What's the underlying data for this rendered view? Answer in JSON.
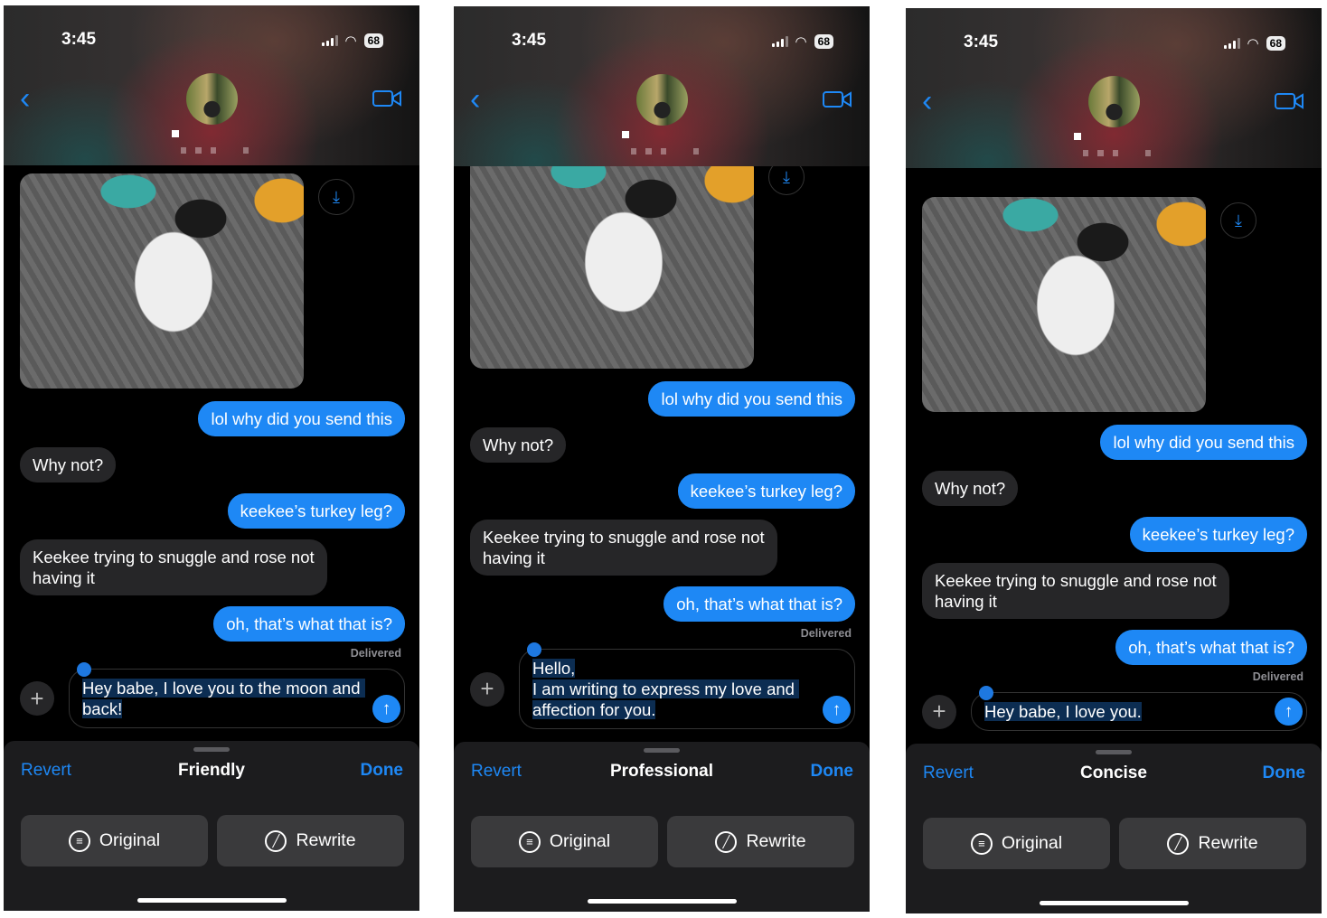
{
  "colors": {
    "accent": "#1e88f5",
    "incoming_bubble": "#262628",
    "sheet": "#1c1c1e"
  },
  "icons": {
    "back": "chevron-left-icon",
    "video": "video-camera-icon",
    "save": "save-to-photos-icon",
    "plus": "plus-icon",
    "send": "arrow-up-icon",
    "original": "original-text-icon",
    "rewrite": "rewrite-icon"
  },
  "phones": [
    {
      "time": "3:45",
      "battery": "68",
      "messages": [
        {
          "dir": "out",
          "text": "lol why did you send this"
        },
        {
          "dir": "in",
          "text": "Why not?"
        },
        {
          "dir": "out",
          "text": "keekee’s turkey leg?"
        },
        {
          "dir": "in",
          "text": "Keekee trying to snuggle and rose not having it"
        },
        {
          "dir": "out",
          "text": "oh, that’s what that is?"
        }
      ],
      "delivered": "Delivered",
      "input_text": "Hey babe, I love you to the moon and back!",
      "sheet": {
        "revert": "Revert",
        "mode": "Friendly",
        "done": "Done",
        "original": "Original",
        "rewrite": "Rewrite"
      }
    },
    {
      "time": "3:45",
      "battery": "68",
      "messages": [
        {
          "dir": "out",
          "text": "lol why did you send this"
        },
        {
          "dir": "in",
          "text": "Why not?"
        },
        {
          "dir": "out",
          "text": "keekee’s turkey leg?"
        },
        {
          "dir": "in",
          "text": "Keekee trying to snuggle and rose not having it"
        },
        {
          "dir": "out",
          "text": "oh, that’s what that is?"
        }
      ],
      "delivered": "Delivered",
      "input_text": "Hello,\nI am writing to express my love and affection for you.",
      "sheet": {
        "revert": "Revert",
        "mode": "Professional",
        "done": "Done",
        "original": "Original",
        "rewrite": "Rewrite"
      }
    },
    {
      "time": "3:45",
      "battery": "68",
      "messages": [
        {
          "dir": "out",
          "text": "lol why did you send this"
        },
        {
          "dir": "in",
          "text": "Why not?"
        },
        {
          "dir": "out",
          "text": "keekee’s turkey leg?"
        },
        {
          "dir": "in",
          "text": "Keekee trying to snuggle and rose not having it"
        },
        {
          "dir": "out",
          "text": "oh, that’s what that is?"
        }
      ],
      "delivered": "Delivered",
      "input_text": "Hey babe, I love you.",
      "sheet": {
        "revert": "Revert",
        "mode": "Concise",
        "done": "Done",
        "original": "Original",
        "rewrite": "Rewrite"
      }
    }
  ]
}
